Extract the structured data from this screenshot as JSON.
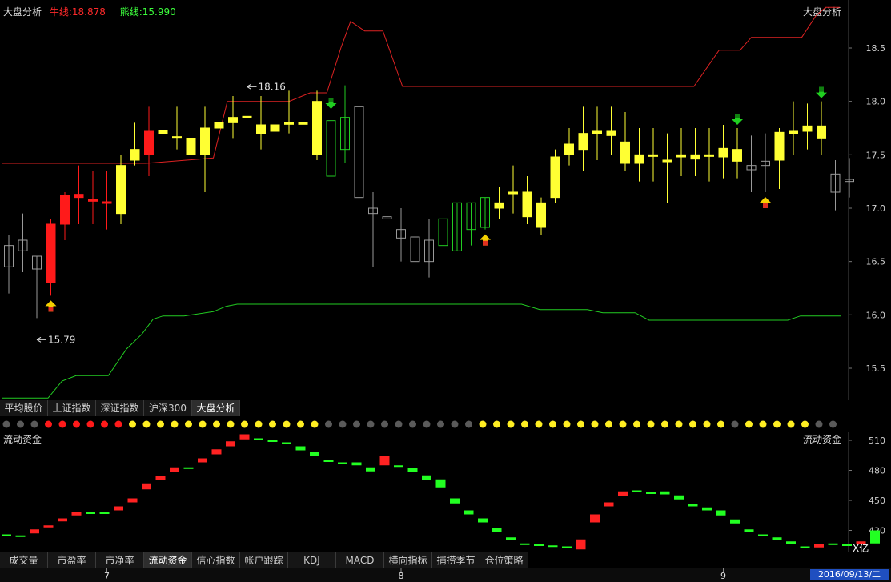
{
  "main_panel": {
    "title": "大盘分析",
    "upper_label": "牛线:18.878",
    "lower_label": "熊线:15.990",
    "title_right": "大盘分析"
  },
  "main_tabs": [
    "平均股价",
    "上证指数",
    "深证指数",
    "沪深300",
    "大盘分析"
  ],
  "main_tabs_active": 4,
  "sub_panel": {
    "title": "流动资金",
    "title_right": "流动资金",
    "unit": "X亿"
  },
  "bottom_tabs": [
    "成交量",
    "市盈率",
    "市净率",
    "流动资金",
    "信心指数",
    "帐户跟踪",
    "KDJ",
    "MACD",
    "横向指标",
    "捕捞季节",
    "仓位策略"
  ],
  "bottom_tabs_active": 3,
  "date_axis": {
    "labels": [
      {
        "text": "7",
        "i": 7
      },
      {
        "text": "8",
        "i": 28
      },
      {
        "text": "9",
        "i": 51
      }
    ],
    "current_date": "2016/09/13/二"
  },
  "signal_dots": [
    "gray",
    "gray",
    "gray",
    "red",
    "red",
    "red",
    "red",
    "red",
    "red",
    "yellow",
    "yellow",
    "yellow",
    "yellow",
    "yellow",
    "yellow",
    "yellow",
    "yellow",
    "yellow",
    "yellow",
    "yellow",
    "yellow",
    "yellow",
    "yellow",
    "gray",
    "gray",
    "gray",
    "gray",
    "gray",
    "gray",
    "gray",
    "gray",
    "gray",
    "gray",
    "gray",
    "yellow",
    "yellow",
    "yellow",
    "yellow",
    "yellow",
    "yellow",
    "yellow",
    "yellow",
    "yellow",
    "yellow",
    "yellow",
    "yellow",
    "yellow",
    "yellow",
    "yellow",
    "yellow",
    "yellow",
    "yellow",
    "gray",
    "yellow",
    "yellow",
    "yellow",
    "yellow",
    "yellow",
    "gray",
    "gray"
  ],
  "colors": {
    "up": "#ff1a1a",
    "yellow": "#ffff33",
    "down_hollow": "#22cc22",
    "gray": "#9a9a9a",
    "bull_line": "#dd2222",
    "bear_line": "#22cc22",
    "flow_up": "#ff2222",
    "flow_down": "#22ff22"
  },
  "chart_data": [
    {
      "type": "candlestick",
      "ylim": [
        15.2,
        18.95
      ],
      "y_ticks": [
        "15.5",
        "16.0",
        "16.5",
        "17.0",
        "17.5",
        "18.0",
        "18.5"
      ],
      "annotations": [
        {
          "text": "15.79",
          "i": 2,
          "value": 15.79
        },
        {
          "text": "18.16",
          "i": 17,
          "value": 18.16
        }
      ],
      "candles": [
        {
          "o": 16.45,
          "h": 16.75,
          "l": 16.2,
          "c": 16.65,
          "k": "g"
        },
        {
          "o": 16.6,
          "h": 16.95,
          "l": 16.4,
          "c": 16.7,
          "k": "g"
        },
        {
          "o": 16.43,
          "h": 16.55,
          "l": 15.97,
          "c": 16.55,
          "k": "g"
        },
        {
          "o": 16.3,
          "h": 16.9,
          "l": 16.18,
          "c": 16.85,
          "k": "r"
        },
        {
          "o": 16.85,
          "h": 17.15,
          "l": 16.7,
          "c": 17.12,
          "k": "r"
        },
        {
          "o": 17.1,
          "h": 17.4,
          "l": 16.85,
          "c": 17.13,
          "k": "r"
        },
        {
          "o": 17.08,
          "h": 17.35,
          "l": 16.85,
          "c": 17.07,
          "k": "r"
        },
        {
          "o": 17.06,
          "h": 17.35,
          "l": 16.8,
          "c": 17.06,
          "k": "r"
        },
        {
          "o": 16.95,
          "h": 17.5,
          "l": 16.85,
          "c": 17.4,
          "k": "y"
        },
        {
          "o": 17.45,
          "h": 17.8,
          "l": 17.4,
          "c": 17.55,
          "k": "y"
        },
        {
          "o": 17.5,
          "h": 17.95,
          "l": 17.3,
          "c": 17.72,
          "k": "r"
        },
        {
          "o": 17.7,
          "h": 18.05,
          "l": 17.45,
          "c": 17.73,
          "k": "y"
        },
        {
          "o": 17.67,
          "h": 17.95,
          "l": 17.55,
          "c": 17.67,
          "k": "y"
        },
        {
          "o": 17.5,
          "h": 17.95,
          "l": 17.3,
          "c": 17.65,
          "k": "y"
        },
        {
          "o": 17.5,
          "h": 17.95,
          "l": 17.15,
          "c": 17.75,
          "k": "y"
        },
        {
          "o": 17.75,
          "h": 18.1,
          "l": 17.6,
          "c": 17.8,
          "k": "y"
        },
        {
          "o": 17.8,
          "h": 18.05,
          "l": 17.65,
          "c": 17.85,
          "k": "y"
        },
        {
          "o": 17.85,
          "h": 18.16,
          "l": 17.72,
          "c": 17.86,
          "k": "y"
        },
        {
          "o": 17.7,
          "h": 18.05,
          "l": 17.55,
          "c": 17.78,
          "k": "y"
        },
        {
          "o": 17.72,
          "h": 18.05,
          "l": 17.5,
          "c": 17.78,
          "k": "y"
        },
        {
          "o": 17.8,
          "h": 18.1,
          "l": 17.7,
          "c": 17.8,
          "k": "y"
        },
        {
          "o": 17.8,
          "h": 18.08,
          "l": 17.65,
          "c": 17.8,
          "k": "y"
        },
        {
          "o": 17.5,
          "h": 18.1,
          "l": 17.45,
          "c": 18.0,
          "k": "y"
        },
        {
          "o": 17.82,
          "h": 17.9,
          "l": 17.3,
          "c": 17.3,
          "k": "gh"
        },
        {
          "o": 17.85,
          "h": 18.15,
          "l": 17.42,
          "c": 17.55,
          "k": "gh"
        },
        {
          "o": 17.95,
          "h": 18.0,
          "l": 17.05,
          "c": 17.1,
          "k": "g"
        },
        {
          "o": 17.0,
          "h": 17.15,
          "l": 16.45,
          "c": 16.95,
          "k": "g"
        },
        {
          "o": 16.92,
          "h": 17.05,
          "l": 16.7,
          "c": 16.9,
          "k": "g"
        },
        {
          "o": 16.8,
          "h": 17.0,
          "l": 16.5,
          "c": 16.72,
          "k": "g"
        },
        {
          "o": 16.73,
          "h": 17.0,
          "l": 16.2,
          "c": 16.5,
          "k": "g"
        },
        {
          "o": 16.7,
          "h": 16.9,
          "l": 16.35,
          "c": 16.5,
          "k": "g"
        },
        {
          "o": 16.9,
          "h": 16.9,
          "l": 16.5,
          "c": 16.65,
          "k": "gh"
        },
        {
          "o": 17.05,
          "h": 17.05,
          "l": 16.6,
          "c": 16.6,
          "k": "gh"
        },
        {
          "o": 17.05,
          "h": 17.05,
          "l": 16.65,
          "c": 16.8,
          "k": "gh"
        },
        {
          "o": 17.1,
          "h": 17.1,
          "l": 16.8,
          "c": 16.82,
          "k": "gh"
        },
        {
          "o": 17.05,
          "h": 17.2,
          "l": 16.9,
          "c": 17.0,
          "k": "y"
        },
        {
          "o": 17.15,
          "h": 17.4,
          "l": 16.95,
          "c": 17.15,
          "k": "y"
        },
        {
          "o": 17.15,
          "h": 17.3,
          "l": 16.85,
          "c": 16.92,
          "k": "y"
        },
        {
          "o": 17.05,
          "h": 17.1,
          "l": 16.75,
          "c": 16.82,
          "k": "y"
        },
        {
          "o": 17.1,
          "h": 17.55,
          "l": 17.05,
          "c": 17.48,
          "k": "y"
        },
        {
          "o": 17.5,
          "h": 17.75,
          "l": 17.4,
          "c": 17.6,
          "k": "y"
        },
        {
          "o": 17.55,
          "h": 17.95,
          "l": 17.35,
          "c": 17.7,
          "k": "y"
        },
        {
          "o": 17.7,
          "h": 17.95,
          "l": 17.45,
          "c": 17.72,
          "k": "y"
        },
        {
          "o": 17.68,
          "h": 17.95,
          "l": 17.5,
          "c": 17.72,
          "k": "y"
        },
        {
          "o": 17.62,
          "h": 17.9,
          "l": 17.35,
          "c": 17.42,
          "k": "y"
        },
        {
          "o": 17.42,
          "h": 17.75,
          "l": 17.25,
          "c": 17.5,
          "k": "y"
        },
        {
          "o": 17.5,
          "h": 17.75,
          "l": 17.25,
          "c": 17.5,
          "k": "y"
        },
        {
          "o": 17.45,
          "h": 17.7,
          "l": 17.05,
          "c": 17.45,
          "k": "y"
        },
        {
          "o": 17.5,
          "h": 17.75,
          "l": 17.3,
          "c": 17.48,
          "k": "y"
        },
        {
          "o": 17.5,
          "h": 17.75,
          "l": 17.3,
          "c": 17.46,
          "k": "y"
        },
        {
          "o": 17.5,
          "h": 17.75,
          "l": 17.25,
          "c": 17.5,
          "k": "y"
        },
        {
          "o": 17.48,
          "h": 17.78,
          "l": 17.28,
          "c": 17.56,
          "k": "y"
        },
        {
          "o": 17.55,
          "h": 17.75,
          "l": 17.28,
          "c": 17.44,
          "k": "y"
        },
        {
          "o": 17.4,
          "h": 17.68,
          "l": 17.15,
          "c": 17.36,
          "k": "g"
        },
        {
          "o": 17.4,
          "h": 17.7,
          "l": 17.15,
          "c": 17.44,
          "k": "g"
        },
        {
          "o": 17.45,
          "h": 17.75,
          "l": 17.18,
          "c": 17.71,
          "k": "y"
        },
        {
          "o": 17.7,
          "h": 18.0,
          "l": 17.5,
          "c": 17.72,
          "k": "y"
        },
        {
          "o": 17.72,
          "h": 17.98,
          "l": 17.55,
          "c": 17.77,
          "k": "y"
        },
        {
          "o": 17.77,
          "h": 18.0,
          "l": 17.5,
          "c": 17.65,
          "k": "y"
        },
        {
          "o": 17.15,
          "h": 17.45,
          "l": 16.98,
          "c": 17.32,
          "k": "g"
        },
        {
          "o": 17.25,
          "h": 17.47,
          "l": 17.1,
          "c": 17.27,
          "k": "g"
        }
      ],
      "bull_line": [
        {
          "i": -0.5,
          "v": 17.42
        },
        {
          "i": 9.8,
          "v": 17.42
        },
        {
          "i": 14.6,
          "v": 17.47
        },
        {
          "i": 15.6,
          "v": 18.0
        },
        {
          "i": 20.0,
          "v": 18.0
        },
        {
          "i": 21.5,
          "v": 18.08
        },
        {
          "i": 22.7,
          "v": 18.08
        },
        {
          "i": 23.7,
          "v": 18.5
        },
        {
          "i": 24.4,
          "v": 18.75
        },
        {
          "i": 25.4,
          "v": 18.66
        },
        {
          "i": 26.7,
          "v": 18.66
        },
        {
          "i": 28.1,
          "v": 18.14
        },
        {
          "i": 48.9,
          "v": 18.14
        },
        {
          "i": 50.7,
          "v": 18.48
        },
        {
          "i": 52.2,
          "v": 18.48
        },
        {
          "i": 53.0,
          "v": 18.6
        },
        {
          "i": 56.6,
          "v": 18.6
        },
        {
          "i": 57.6,
          "v": 18.8
        },
        {
          "i": 58.3,
          "v": 18.88
        },
        {
          "i": 59.3,
          "v": 18.88
        }
      ],
      "bear_line": [
        {
          "i": -0.5,
          "v": 15.22
        },
        {
          "i": 2.8,
          "v": 15.22
        },
        {
          "i": 3.8,
          "v": 15.38
        },
        {
          "i": 4.8,
          "v": 15.43
        },
        {
          "i": 7.1,
          "v": 15.43
        },
        {
          "i": 8.4,
          "v": 15.68
        },
        {
          "i": 9.5,
          "v": 15.82
        },
        {
          "i": 10.3,
          "v": 15.96
        },
        {
          "i": 11.0,
          "v": 15.99
        },
        {
          "i": 12.5,
          "v": 15.99
        },
        {
          "i": 14.6,
          "v": 16.03
        },
        {
          "i": 15.5,
          "v": 16.08
        },
        {
          "i": 16.3,
          "v": 16.1
        },
        {
          "i": 36.6,
          "v": 16.1
        },
        {
          "i": 37.9,
          "v": 16.05
        },
        {
          "i": 41.3,
          "v": 16.05
        },
        {
          "i": 42.4,
          "v": 16.02
        },
        {
          "i": 44.7,
          "v": 16.02
        },
        {
          "i": 45.7,
          "v": 15.95
        },
        {
          "i": 55.6,
          "v": 15.95
        },
        {
          "i": 56.5,
          "v": 15.99
        },
        {
          "i": 59.4,
          "v": 15.99
        }
      ],
      "buy_signals": [
        3,
        34,
        54
      ],
      "sell_signals": [
        23,
        52,
        58
      ]
    },
    {
      "type": "bar",
      "title": "流动资金",
      "ylim": [
        398,
        518
      ],
      "y_ticks": [
        "420",
        "450",
        "480",
        "510"
      ],
      "bars": [
        {
          "v": 415,
          "d": 1,
          "c": "g"
        },
        {
          "v": 414,
          "d": 1,
          "c": "g"
        },
        {
          "v": 417,
          "d": 4,
          "c": "r"
        },
        {
          "v": 423,
          "d": 2,
          "c": "r"
        },
        {
          "v": 429,
          "d": 3,
          "c": "r"
        },
        {
          "v": 435,
          "d": 3,
          "c": "r"
        },
        {
          "v": 437,
          "d": 1,
          "c": "g"
        },
        {
          "v": 437,
          "d": 1,
          "c": "g"
        },
        {
          "v": 440,
          "d": 4,
          "c": "r"
        },
        {
          "v": 448,
          "d": 4,
          "c": "r"
        },
        {
          "v": 461,
          "d": 6,
          "c": "r"
        },
        {
          "v": 470,
          "d": 4,
          "c": "r"
        },
        {
          "v": 478,
          "d": 5,
          "c": "r"
        },
        {
          "v": 482,
          "d": 1,
          "c": "g"
        },
        {
          "v": 488,
          "d": 4,
          "c": "r"
        },
        {
          "v": 496,
          "d": 5,
          "c": "r"
        },
        {
          "v": 504,
          "d": 5,
          "c": "r"
        },
        {
          "v": 511,
          "d": 5,
          "c": "r"
        },
        {
          "v": 511,
          "d": 1,
          "c": "g"
        },
        {
          "v": 509,
          "d": 1,
          "c": "g"
        },
        {
          "v": 506,
          "d": 2,
          "c": "g"
        },
        {
          "v": 500,
          "d": 4,
          "c": "g"
        },
        {
          "v": 494,
          "d": 4,
          "c": "g"
        },
        {
          "v": 489,
          "d": 1,
          "c": "g"
        },
        {
          "v": 487,
          "d": 1,
          "c": "g"
        },
        {
          "v": 485,
          "d": 3,
          "c": "g"
        },
        {
          "v": 479,
          "d": 4,
          "c": "g"
        },
        {
          "v": 485,
          "d": 9,
          "c": "r"
        },
        {
          "v": 484,
          "d": 1,
          "c": "g"
        },
        {
          "v": 478,
          "d": 4,
          "c": "g"
        },
        {
          "v": 470,
          "d": 5,
          "c": "g"
        },
        {
          "v": 463,
          "d": 8,
          "c": "g"
        },
        {
          "v": 447,
          "d": 5,
          "c": "g"
        },
        {
          "v": 436,
          "d": 4,
          "c": "g"
        },
        {
          "v": 428,
          "d": 4,
          "c": "g"
        },
        {
          "v": 418,
          "d": 4,
          "c": "g"
        },
        {
          "v": 410,
          "d": 3,
          "c": "g"
        },
        {
          "v": 406,
          "d": 1,
          "c": "g"
        },
        {
          "v": 405,
          "d": 1,
          "c": "g"
        },
        {
          "v": 404,
          "d": 1,
          "c": "g"
        },
        {
          "v": 403,
          "d": 1,
          "c": "g"
        },
        {
          "v": 401,
          "d": 10,
          "c": "r"
        },
        {
          "v": 428,
          "d": 8,
          "c": "r"
        },
        {
          "v": 444,
          "d": 4,
          "c": "r"
        },
        {
          "v": 454,
          "d": 5,
          "c": "r"
        },
        {
          "v": 459,
          "d": 1,
          "c": "g"
        },
        {
          "v": 457,
          "d": 1,
          "c": "g"
        },
        {
          "v": 456,
          "d": 3,
          "c": "g"
        },
        {
          "v": 451,
          "d": 4,
          "c": "g"
        },
        {
          "v": 444,
          "d": 2,
          "c": "g"
        },
        {
          "v": 440,
          "d": 3,
          "c": "g"
        },
        {
          "v": 435,
          "d": 5,
          "c": "g"
        },
        {
          "v": 427,
          "d": 4,
          "c": "g"
        },
        {
          "v": 418,
          "d": 3,
          "c": "g"
        },
        {
          "v": 414,
          "d": 2,
          "c": "g"
        },
        {
          "v": 410,
          "d": 3,
          "c": "g"
        },
        {
          "v": 406,
          "d": 3,
          "c": "g"
        },
        {
          "v": 403,
          "d": 1,
          "c": "g"
        },
        {
          "v": 403,
          "d": 3,
          "c": "r"
        },
        {
          "v": 406,
          "d": 1,
          "c": "g"
        },
        {
          "v": 405,
          "d": 1,
          "c": "g"
        },
        {
          "v": 406,
          "d": 3,
          "c": "r"
        },
        {
          "v": 407,
          "d": 13,
          "c": "g"
        }
      ]
    }
  ]
}
